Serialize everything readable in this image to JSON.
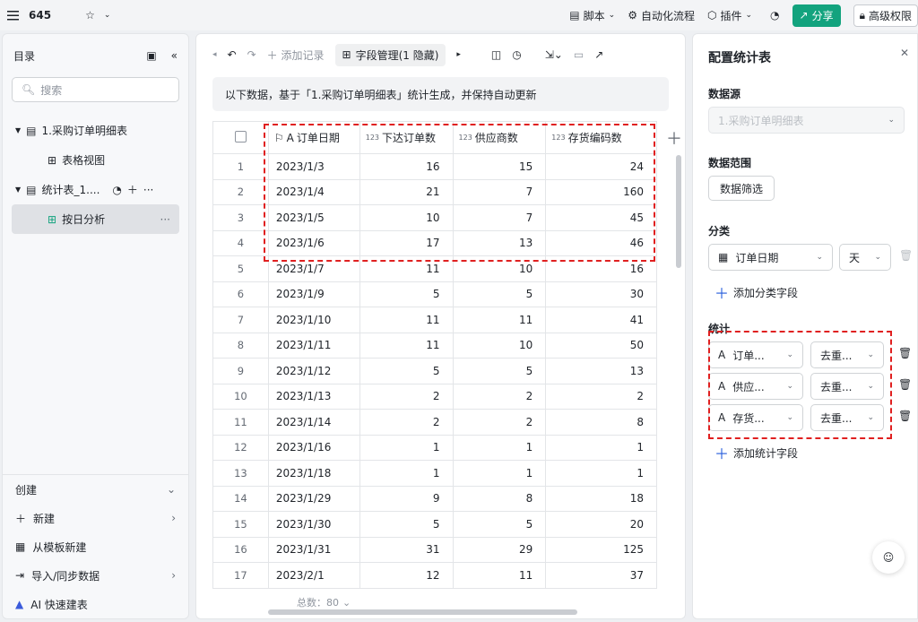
{
  "topbar": {
    "title": "645",
    "script_label": "脚本",
    "automation_label": "自动化流程",
    "plugin_label": "插件",
    "share_label": "分享",
    "advanced_label": "高级权限"
  },
  "sidebar": {
    "title": "目录",
    "search_placeholder": "搜索",
    "tree": [
      {
        "label": "1.采购订单明细表"
      },
      {
        "label": "表格视图"
      },
      {
        "label": "统计表_1...."
      },
      {
        "label": "按日分析"
      }
    ],
    "bottom": {
      "create_label": "创建",
      "items": [
        {
          "label": "新建"
        },
        {
          "label": "从模板新建"
        },
        {
          "label": "导入/同步数据"
        },
        {
          "label": "AI 快速建表"
        }
      ]
    }
  },
  "toolbar": {
    "add_record_label": "添加记录",
    "field_manage_label": "字段管理(1 隐藏)"
  },
  "notice": "以下数据，基于「1.采购订单明细表」统计生成，并保持自动更新",
  "table": {
    "columns": [
      "订单日期",
      "下达订单数",
      "供应商数",
      "存货编码数"
    ],
    "rows": [
      {
        "idx": "1",
        "date": "2023/1/3",
        "orders": "16",
        "suppliers": "15",
        "items": "24"
      },
      {
        "idx": "2",
        "date": "2023/1/4",
        "orders": "21",
        "suppliers": "7",
        "items": "160"
      },
      {
        "idx": "3",
        "date": "2023/1/5",
        "orders": "10",
        "suppliers": "7",
        "items": "45"
      },
      {
        "idx": "4",
        "date": "2023/1/6",
        "orders": "17",
        "suppliers": "13",
        "items": "46"
      },
      {
        "idx": "5",
        "date": "2023/1/7",
        "orders": "11",
        "suppliers": "10",
        "items": "16"
      },
      {
        "idx": "6",
        "date": "2023/1/9",
        "orders": "5",
        "suppliers": "5",
        "items": "30"
      },
      {
        "idx": "7",
        "date": "2023/1/10",
        "orders": "11",
        "suppliers": "11",
        "items": "41"
      },
      {
        "idx": "8",
        "date": "2023/1/11",
        "orders": "11",
        "suppliers": "10",
        "items": "50"
      },
      {
        "idx": "9",
        "date": "2023/1/12",
        "orders": "5",
        "suppliers": "5",
        "items": "13"
      },
      {
        "idx": "10",
        "date": "2023/1/13",
        "orders": "2",
        "suppliers": "2",
        "items": "2"
      },
      {
        "idx": "11",
        "date": "2023/1/14",
        "orders": "2",
        "suppliers": "2",
        "items": "8"
      },
      {
        "idx": "12",
        "date": "2023/1/16",
        "orders": "1",
        "suppliers": "1",
        "items": "1"
      },
      {
        "idx": "13",
        "date": "2023/1/18",
        "orders": "1",
        "suppliers": "1",
        "items": "1"
      },
      {
        "idx": "14",
        "date": "2023/1/29",
        "orders": "9",
        "suppliers": "8",
        "items": "18"
      },
      {
        "idx": "15",
        "date": "2023/1/30",
        "orders": "5",
        "suppliers": "5",
        "items": "20"
      },
      {
        "idx": "16",
        "date": "2023/1/31",
        "orders": "31",
        "suppliers": "29",
        "items": "125"
      },
      {
        "idx": "17",
        "date": "2023/2/1",
        "orders": "12",
        "suppliers": "11",
        "items": "37"
      }
    ],
    "total_label": "总数：80"
  },
  "panel": {
    "title": "配置统计表",
    "datasource_label": "数据源",
    "datasource_value": "1.采购订单明细表",
    "range_label": "数据范围",
    "filter_label": "数据筛选",
    "group_label": "分类",
    "group_field": "订单日期",
    "group_unit": "天",
    "add_group_label": "添加分类字段",
    "stats_label": "统计",
    "stats": [
      {
        "field": "订单...",
        "method": "去重..."
      },
      {
        "field": "供应...",
        "method": "去重..."
      },
      {
        "field": "存货...",
        "method": "去重..."
      }
    ],
    "add_stat_label": "添加统计字段"
  },
  "colors": {
    "accent": "#13a37e",
    "highlight": "#e02020",
    "link": "#245bdb"
  }
}
